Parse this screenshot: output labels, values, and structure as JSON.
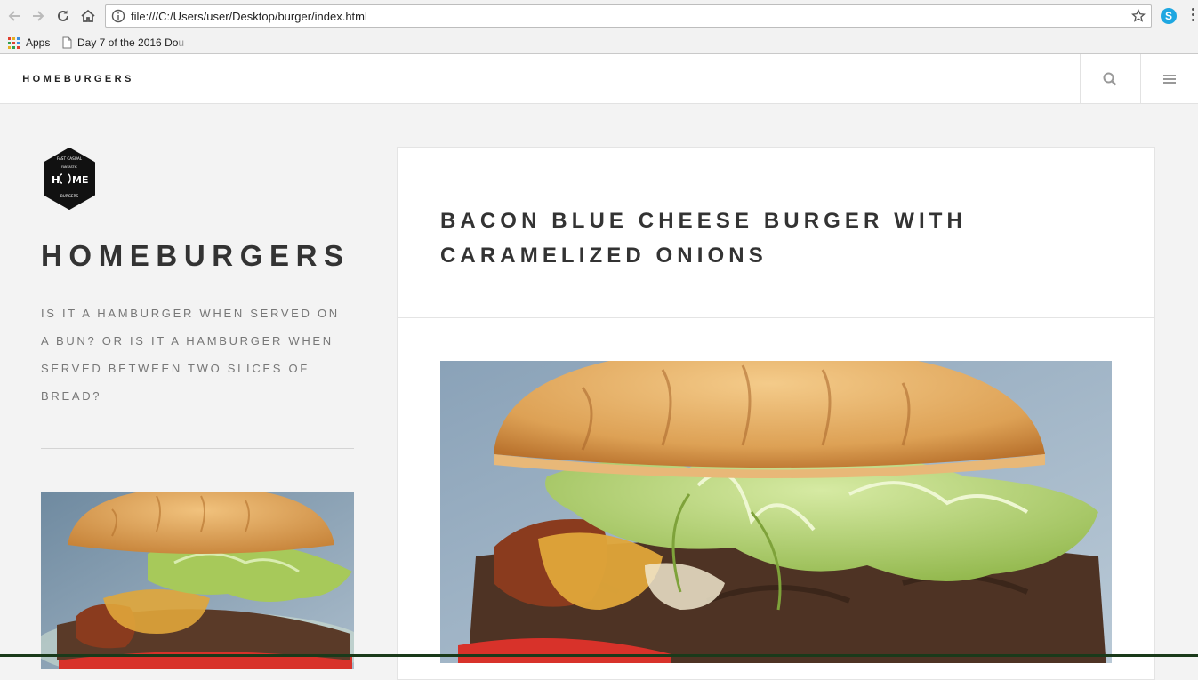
{
  "browser": {
    "url": "file:///C:/Users/user/Desktop/burger/index.html",
    "icons": [
      "back-arrow-icon",
      "forward-arrow-icon",
      "reload-icon",
      "home-icon",
      "info-icon",
      "bookmark-star-icon",
      "skype-icon",
      "menu-kebab-icon"
    ],
    "skype_glyph": "S"
  },
  "bookmarks": {
    "apps_label": "Apps",
    "item_label": "Day 7 of the 2016 Do",
    "item_ghost": "u"
  },
  "header": {
    "brand": "HOMEBURGERS",
    "icons": [
      "search-icon",
      "hamburger-menu-icon"
    ]
  },
  "sidebar": {
    "logo_text": {
      "top": "FAST CASUAL",
      "middle": "FANTASTIC",
      "word_left": "H",
      "word_right": "ME",
      "bottom": "BURGERS"
    },
    "title": "HOMEBURGERS",
    "tagline": "Is it a hamburger when served on a bun? Or is it a hamburger when served between two slices of bread?"
  },
  "post": {
    "title": "Bacon Blue Cheese Burger with Caramelized Onions"
  },
  "colors": {
    "page_bg": "#f3f3f3",
    "card_bg": "#ffffff",
    "text_dark": "#333333",
    "text_muted": "#777777",
    "bun": "#d89a4e",
    "lettuce": "#a7c95a",
    "patty": "#5a3a28",
    "tomato": "#d8322a",
    "cheese": "#e0a63a"
  }
}
